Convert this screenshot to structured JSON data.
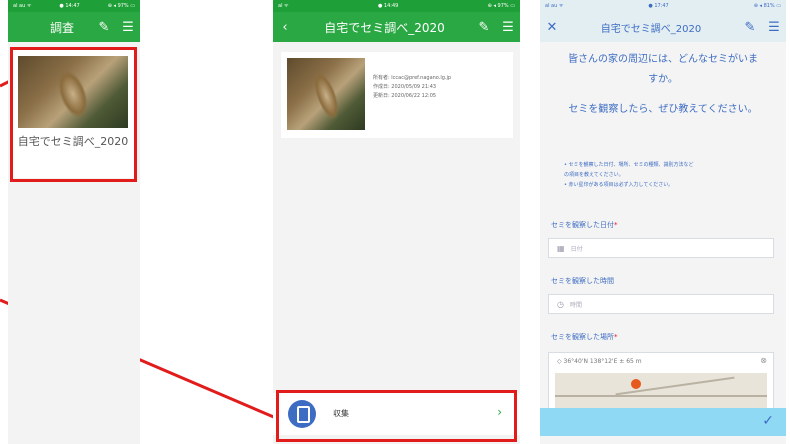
{
  "colors": {
    "green": "#2aa843",
    "blue": "#3d6cc3",
    "highlight": "#e21b1b"
  },
  "screen1": {
    "status": {
      "left": "al au ᯤ",
      "time": "● 14:47",
      "right": "⊕ ◂ 97% ▭"
    },
    "header_title": "調査",
    "header_icons": [
      "pen-icon",
      "menu-icon"
    ],
    "card_title": "自宅でセミ調べ_2020"
  },
  "screen2": {
    "status": {
      "left": "al ᯤ",
      "time": "● 14:49",
      "right": "⊕ ◂ 97% ▭"
    },
    "header_title": "自宅でセミ調べ_2020",
    "header_icons": [
      "back-icon",
      "pen-icon",
      "menu-icon"
    ],
    "meta": {
      "owner": "所有者: lccac@pref.nagano.lg.jp",
      "created": "作成日: 2020/05/09 21:43",
      "updated": "更新日: 2020/06/22 12:05"
    },
    "collect_label": "収集"
  },
  "screen3": {
    "status": {
      "left": "al au ᯤ",
      "time": "● 17:47",
      "right": "⊕ ◂ 81% ▭"
    },
    "header_title": "自宅でセミ調べ_2020",
    "header_icons": [
      "close-icon",
      "pen-icon",
      "menu-icon"
    ],
    "question_line1": "皆さんの家の周辺には、どんなセミがいま",
    "question_line2": "すか。",
    "question_line3": "セミを観察したら、ぜひ教えてください。",
    "bullets": [
      "• セミを観察した日付、場所、セミの種類、識別方法など",
      "  の項目を教えてください。",
      "• 赤い星印がある項目は必ず入力してください。"
    ],
    "fields": [
      {
        "label": "セミを観察した日付",
        "required": "*",
        "placeholder": "日付",
        "icon": "calendar-icon"
      },
      {
        "label": "セミを観察した時間",
        "required": "",
        "placeholder": "時間",
        "icon": "clock-icon"
      }
    ],
    "location_label": "セミを観察した場所",
    "location_required": "*",
    "location_value": "36°40'N 138°12'E ± 65 m"
  }
}
